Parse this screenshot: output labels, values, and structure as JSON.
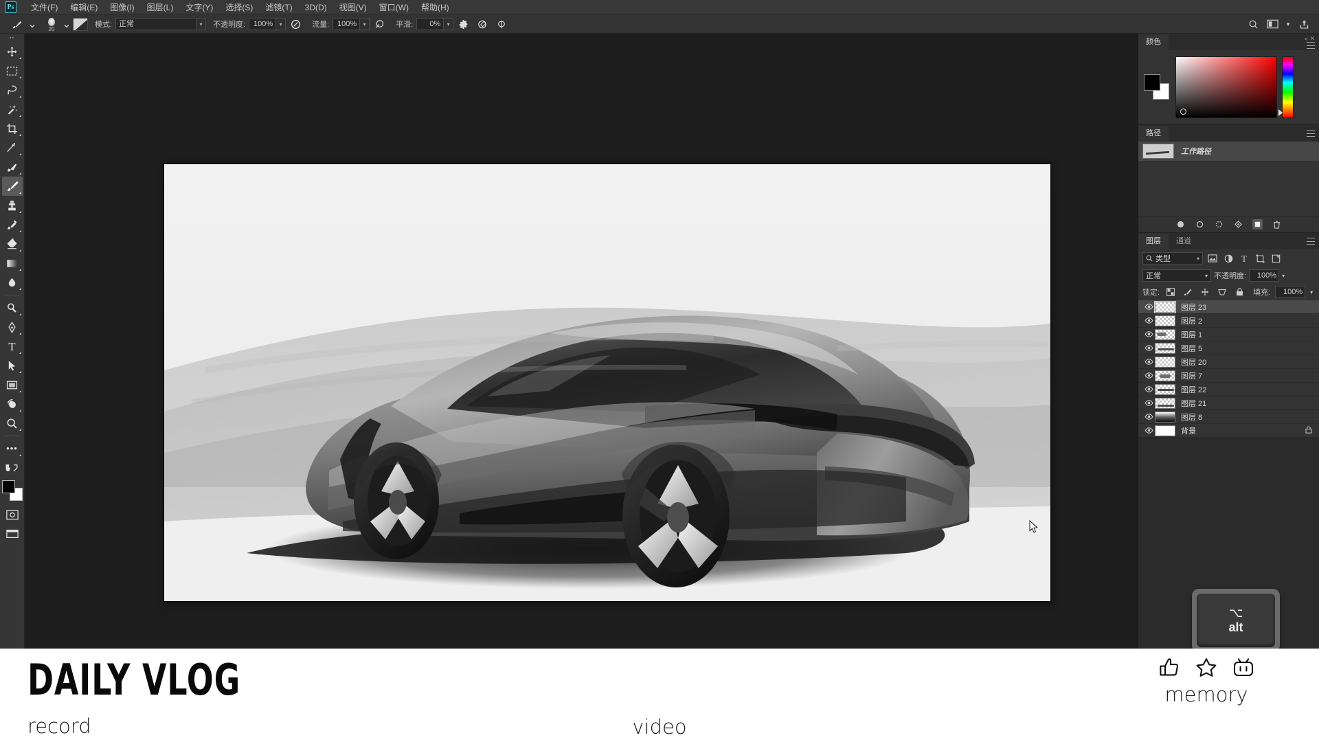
{
  "app": {
    "name": "Photoshop",
    "logo_text": "Ps"
  },
  "menubar": {
    "items": [
      {
        "label": "文件(F)",
        "name": "menu-file"
      },
      {
        "label": "编辑(E)",
        "name": "menu-edit"
      },
      {
        "label": "图像(I)",
        "name": "menu-image"
      },
      {
        "label": "图层(L)",
        "name": "menu-layer"
      },
      {
        "label": "文字(Y)",
        "name": "menu-type"
      },
      {
        "label": "选择(S)",
        "name": "menu-select"
      },
      {
        "label": "滤镜(T)",
        "name": "menu-filter"
      },
      {
        "label": "3D(D)",
        "name": "menu-3d"
      },
      {
        "label": "视图(V)",
        "name": "menu-view"
      },
      {
        "label": "窗口(W)",
        "name": "menu-window"
      },
      {
        "label": "帮助(H)",
        "name": "menu-help"
      }
    ]
  },
  "options_bar": {
    "brush_size": "20",
    "mode_label": "模式:",
    "mode_value": "正常",
    "opacity_label": "不透明度:",
    "opacity_value": "100%",
    "flow_label": "流量:",
    "flow_value": "100%",
    "smoothing_label": "平滑:",
    "smoothing_value": "0%",
    "icons": [
      "settings-gear-icon",
      "airbrush-icon",
      "symmetry-icon"
    ],
    "right_icons": [
      "search-icon",
      "workspace-switcher-icon",
      "share-icon"
    ]
  },
  "toolbar": {
    "tools": [
      {
        "name": "move-tool",
        "glyph": "✥",
        "active": false
      },
      {
        "name": "rectangular-marquee-tool",
        "glyph": "▭",
        "active": false
      },
      {
        "name": "lasso-tool",
        "glyph": "✦",
        "active": false
      },
      {
        "name": "magic-wand-tool",
        "glyph": "✶",
        "active": false
      },
      {
        "name": "crop-tool",
        "glyph": "⌗",
        "active": false
      },
      {
        "name": "eyedropper-tool",
        "glyph": "✎",
        "active": false
      },
      {
        "name": "healing-brush-tool",
        "glyph": "✐",
        "active": false
      },
      {
        "name": "brush-tool",
        "glyph": "✏",
        "active": true
      },
      {
        "name": "clone-stamp-tool",
        "glyph": "✇",
        "active": false
      },
      {
        "name": "history-brush-tool",
        "glyph": "✒",
        "active": false
      },
      {
        "name": "eraser-tool",
        "glyph": "◨",
        "active": false
      },
      {
        "name": "gradient-tool",
        "glyph": "▤",
        "active": false
      },
      {
        "name": "blur-tool",
        "glyph": "☁",
        "active": false
      },
      {
        "name": "dodge-tool",
        "glyph": "◐",
        "active": false
      },
      {
        "name": "pen-tool",
        "glyph": "✑",
        "active": false
      },
      {
        "name": "type-tool",
        "glyph": "T",
        "active": false
      },
      {
        "name": "path-selection-tool",
        "glyph": "➤",
        "active": false
      },
      {
        "name": "rectangle-shape-tool",
        "glyph": "▢",
        "active": false
      },
      {
        "name": "orbit-3d-tool",
        "glyph": "◑",
        "active": false
      },
      {
        "name": "zoom-tool",
        "glyph": "◯",
        "active": false
      },
      {
        "name": "more-tools",
        "glyph": "•••",
        "active": false
      }
    ],
    "quick_mask_name": "quick-mask-toggle",
    "screen_mode_name": "screen-mode-toggle",
    "foreground_color": "#000000",
    "background_color": "#ffffff"
  },
  "color_panel": {
    "tab": "颜色",
    "foreground_color": "#000000",
    "background_color": "#ffffff",
    "field_hue": "#ff0000"
  },
  "paths_panel": {
    "tab": "路径",
    "rows": [
      {
        "name": "工作路径",
        "selected": true
      }
    ],
    "footer_icons": [
      "fill-path-icon",
      "stroke-path-icon",
      "load-selection-icon",
      "make-work-path-icon",
      "new-path-icon",
      "delete-path-icon"
    ]
  },
  "layers_panel": {
    "tabs": [
      {
        "label": "图层",
        "active": true
      },
      {
        "label": "通道",
        "active": false
      }
    ],
    "filter_label": "类型",
    "filter_icons": [
      "pixel-filter-icon",
      "adjustment-filter-icon",
      "type-filter-icon",
      "shape-filter-icon",
      "smart-object-filter-icon"
    ],
    "blend_mode": "正常",
    "opacity_label": "不透明度:",
    "opacity_value": "100%",
    "lock_label": "锁定:",
    "lock_icons": [
      "lock-transparent-pixels-icon",
      "lock-image-pixels-icon",
      "lock-position-icon",
      "lock-artboard-icon",
      "lock-all-icon"
    ],
    "fill_label": "填充:",
    "fill_value": "100%",
    "layers": [
      {
        "name": "图层 23",
        "selected": true,
        "visible": true,
        "thumb": "checker",
        "locked": false
      },
      {
        "name": "图层 2",
        "selected": false,
        "visible": true,
        "thumb": "checker",
        "locked": false
      },
      {
        "name": "图层 1",
        "selected": false,
        "visible": true,
        "thumb": "marks",
        "locked": false
      },
      {
        "name": "图层 5",
        "selected": false,
        "visible": true,
        "thumb": "marks",
        "locked": false
      },
      {
        "name": "图层 20",
        "selected": false,
        "visible": true,
        "thumb": "checker",
        "locked": false
      },
      {
        "name": "图层 7",
        "selected": false,
        "visible": true,
        "thumb": "marks",
        "locked": false
      },
      {
        "name": "图层 22",
        "selected": false,
        "visible": true,
        "thumb": "marks",
        "locked": false
      },
      {
        "name": "图层 21",
        "selected": false,
        "visible": true,
        "thumb": "marks",
        "locked": false
      },
      {
        "name": "图层 8",
        "selected": false,
        "visible": true,
        "thumb": "grad",
        "locked": false
      },
      {
        "name": "背景",
        "selected": false,
        "visible": true,
        "thumb": "white",
        "locked": true
      }
    ]
  },
  "key_overlay": {
    "symbol": "⌥",
    "label": "alt"
  },
  "canvas": {
    "artwork_title": "concept-car-greyscale-sketch",
    "description": "Greyscale digital painting of a futuristic sports car, three-quarter rear view"
  },
  "brandbar": {
    "title": "DAILY VLOG",
    "subtitle": "record",
    "center_text": "video",
    "right_label": "memory",
    "right_icons": [
      "thumbs-up-icon",
      "star-icon",
      "bilibili-tv-icon"
    ]
  }
}
